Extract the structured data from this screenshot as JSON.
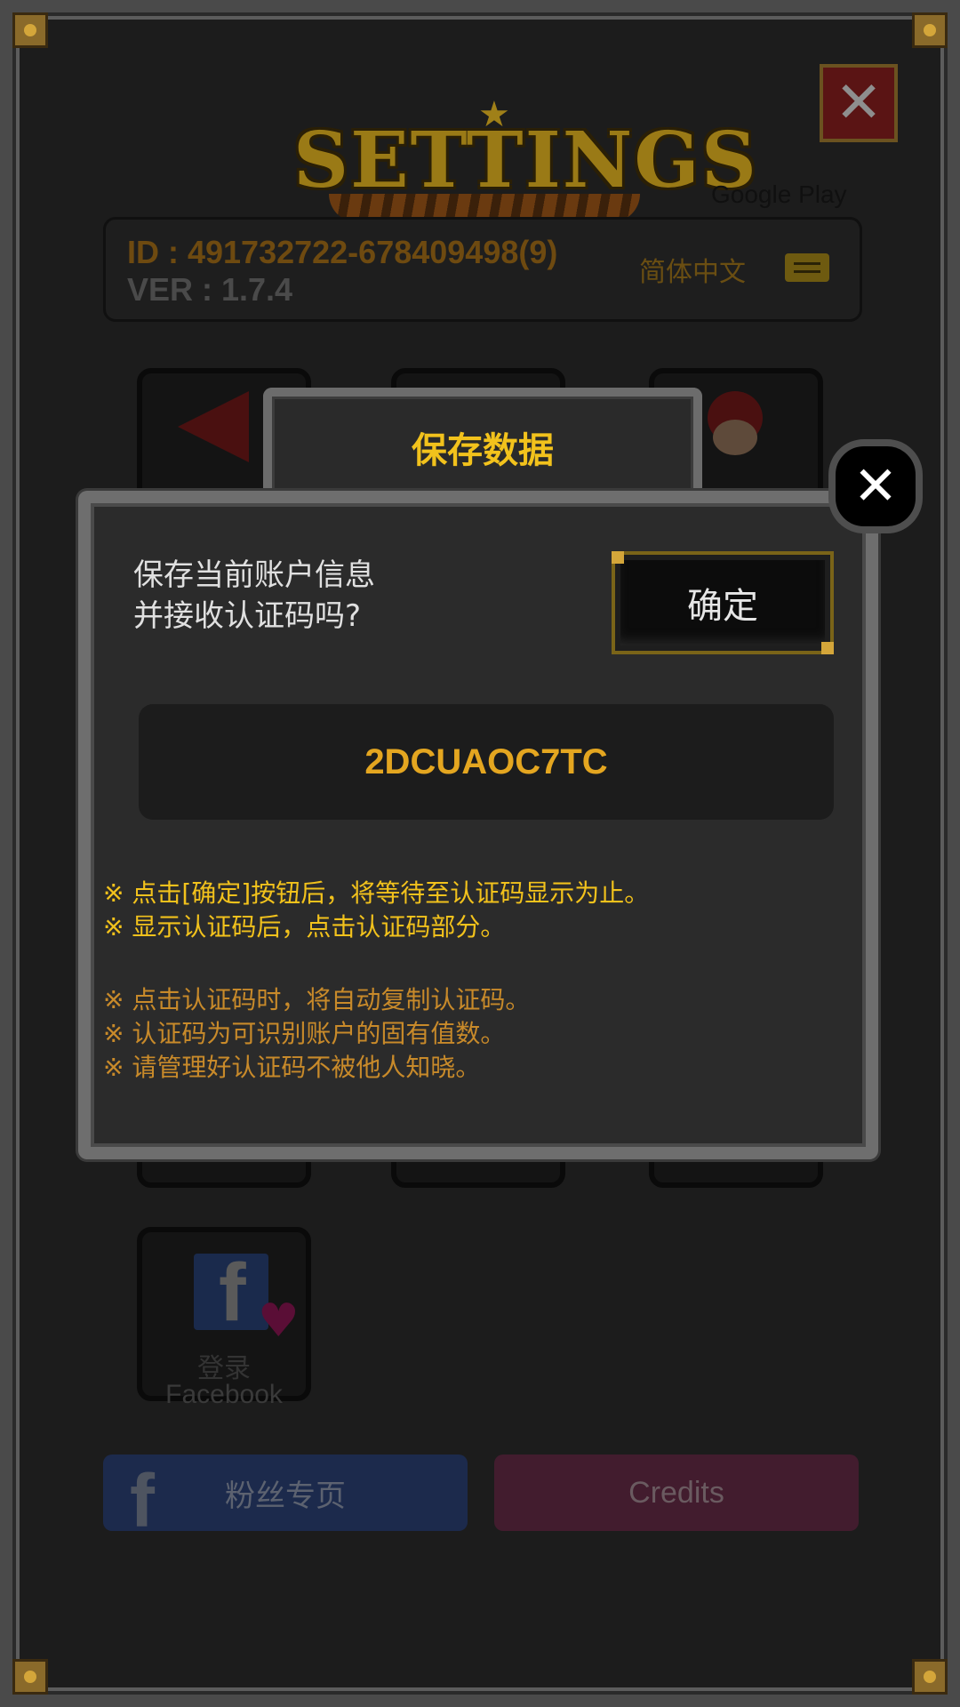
{
  "header": {
    "title": "SETTINGS",
    "close_glyph": "✕",
    "google_play": "Google Play"
  },
  "info": {
    "id": "ID : 491732722-678409498(9)",
    "version": "VER : 1.7.4",
    "language": "简体中文"
  },
  "grid": {
    "facebook_login_line1": "登录",
    "facebook_login_line2": "Facebook"
  },
  "bottom": {
    "fan_page": "粉丝专页",
    "credits": "Credits"
  },
  "modal": {
    "title": "保存数据",
    "close_glyph": "✕",
    "prompt_line1": "保存当前账户信息",
    "prompt_line2": "并接收认证码吗?",
    "confirm": "确定",
    "code": "2DCUAOC7TC",
    "notes_highlight": [
      "※ 点击[确定]按钮后，将等待至认证码显示为止。",
      "※ 显示认证码后，点击认证码部分。"
    ],
    "notes_info": [
      "※ 点击认证码时，将自动复制认证码。",
      "※ 认证码为可识别账户的固有值数。",
      "※ 请管理好认证码不被他人知晓。"
    ]
  },
  "colors": {
    "accent_yellow": "#f2c21c",
    "code_orange": "#e4a620",
    "note_orange": "#c88a2a",
    "facebook_blue": "#1c2a4c",
    "credits_purple": "#421c2e"
  }
}
